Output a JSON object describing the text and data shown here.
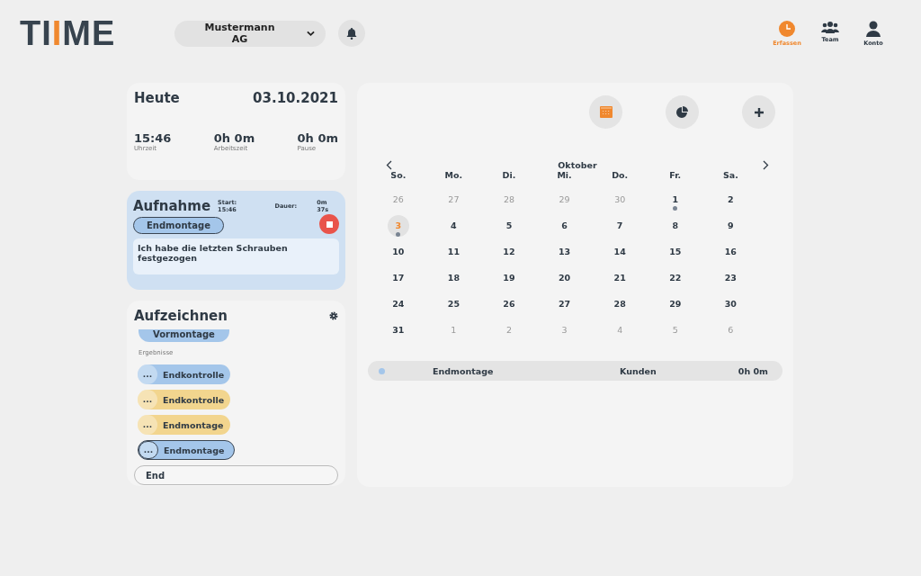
{
  "header": {
    "logo": [
      {
        "text": "TI",
        "kind": "plain"
      },
      {
        "text": "I",
        "kind": "accent"
      },
      {
        "text": "ME",
        "kind": "plain"
      }
    ],
    "company": "Mustermann AG",
    "nav": [
      {
        "label": "Erfassen",
        "kind": "clock",
        "selected": true
      },
      {
        "label": "Team",
        "kind": "team",
        "selected": false
      },
      {
        "label": "Konto",
        "kind": "user",
        "selected": false
      }
    ]
  },
  "today": {
    "title": "Heute",
    "date": "03.10.2021",
    "stats": [
      {
        "value": "15:46",
        "label": "Uhrzeit"
      },
      {
        "value": "0h 0m",
        "label": "Arbeitszeit"
      },
      {
        "value": "0h 0m",
        "label": "Pause"
      }
    ]
  },
  "recording": {
    "title": "Aufnahme",
    "start": "Start: 15:46",
    "duration_label": "Dauer:",
    "duration": "0m 37s",
    "task": "Endmontage",
    "note": "Ich habe die letzten Schrauben festgezogen"
  },
  "log": {
    "title": "Aufzeichnen",
    "partial_item": "Vormontage",
    "results_label": "Ergebnisse",
    "results": [
      {
        "label": "Endkontrolle",
        "more": "...",
        "color": "#a4c6ea",
        "selected": false
      },
      {
        "label": "Endkontrolle",
        "more": "...",
        "color": "#f2d58e",
        "selected": false
      },
      {
        "label": "Endmontage",
        "more": "...",
        "color": "#f2d58e",
        "selected": false
      },
      {
        "label": "Endmontage",
        "more": "...",
        "color": "#a4c6ea",
        "selected": true
      }
    ],
    "search_value": "End"
  },
  "calendar": {
    "toolbar": [
      {
        "kind": "calendar"
      },
      {
        "kind": "chart"
      },
      {
        "kind": "plus"
      }
    ],
    "month": "Oktober",
    "weekdays": [
      "So.",
      "Mo.",
      "Di.",
      "Mi.",
      "Do.",
      "Fr.",
      "Sa."
    ],
    "days": [
      {
        "label": "26",
        "muted": true,
        "selected": false,
        "entry": false
      },
      {
        "label": "27",
        "muted": true,
        "selected": false,
        "entry": false
      },
      {
        "label": "28",
        "muted": true,
        "selected": false,
        "entry": false
      },
      {
        "label": "29",
        "muted": true,
        "selected": false,
        "entry": false
      },
      {
        "label": "30",
        "muted": true,
        "selected": false,
        "entry": false
      },
      {
        "label": "1",
        "muted": false,
        "selected": false,
        "entry": true
      },
      {
        "label": "2",
        "muted": false,
        "selected": false,
        "entry": false
      },
      {
        "label": "3",
        "muted": false,
        "selected": true,
        "entry": true
      },
      {
        "label": "4",
        "muted": false,
        "selected": false,
        "entry": false
      },
      {
        "label": "5",
        "muted": false,
        "selected": false,
        "entry": false
      },
      {
        "label": "6",
        "muted": false,
        "selected": false,
        "entry": false
      },
      {
        "label": "7",
        "muted": false,
        "selected": false,
        "entry": false
      },
      {
        "label": "8",
        "muted": false,
        "selected": false,
        "entry": false
      },
      {
        "label": "9",
        "muted": false,
        "selected": false,
        "entry": false
      },
      {
        "label": "10",
        "muted": false,
        "selected": false,
        "entry": false
      },
      {
        "label": "11",
        "muted": false,
        "selected": false,
        "entry": false
      },
      {
        "label": "12",
        "muted": false,
        "selected": false,
        "entry": false
      },
      {
        "label": "13",
        "muted": false,
        "selected": false,
        "entry": false
      },
      {
        "label": "14",
        "muted": false,
        "selected": false,
        "entry": false
      },
      {
        "label": "15",
        "muted": false,
        "selected": false,
        "entry": false
      },
      {
        "label": "16",
        "muted": false,
        "selected": false,
        "entry": false
      },
      {
        "label": "17",
        "muted": false,
        "selected": false,
        "entry": false
      },
      {
        "label": "18",
        "muted": false,
        "selected": false,
        "entry": false
      },
      {
        "label": "19",
        "muted": false,
        "selected": false,
        "entry": false
      },
      {
        "label": "20",
        "muted": false,
        "selected": false,
        "entry": false
      },
      {
        "label": "21",
        "muted": false,
        "selected": false,
        "entry": false
      },
      {
        "label": "22",
        "muted": false,
        "selected": false,
        "entry": false
      },
      {
        "label": "23",
        "muted": false,
        "selected": false,
        "entry": false
      },
      {
        "label": "24",
        "muted": false,
        "selected": false,
        "entry": false
      },
      {
        "label": "25",
        "muted": false,
        "selected": false,
        "entry": false
      },
      {
        "label": "26",
        "muted": false,
        "selected": false,
        "entry": false
      },
      {
        "label": "27",
        "muted": false,
        "selected": false,
        "entry": false
      },
      {
        "label": "28",
        "muted": false,
        "selected": false,
        "entry": false
      },
      {
        "label": "29",
        "muted": false,
        "selected": false,
        "entry": false
      },
      {
        "label": "30",
        "muted": false,
        "selected": false,
        "entry": false
      },
      {
        "label": "31",
        "muted": false,
        "selected": false,
        "entry": false
      },
      {
        "label": "1",
        "muted": true,
        "selected": false,
        "entry": false
      },
      {
        "label": "2",
        "muted": true,
        "selected": false,
        "entry": false
      },
      {
        "label": "3",
        "muted": true,
        "selected": false,
        "entry": false
      },
      {
        "label": "4",
        "muted": true,
        "selected": false,
        "entry": false
      },
      {
        "label": "5",
        "muted": true,
        "selected": false,
        "entry": false
      },
      {
        "label": "6",
        "muted": true,
        "selected": false,
        "entry": false
      }
    ],
    "entries": [
      {
        "task": "Endmontage",
        "customer": "Kunden",
        "duration": "0h 0m",
        "color": "#a4c6ea"
      }
    ]
  }
}
